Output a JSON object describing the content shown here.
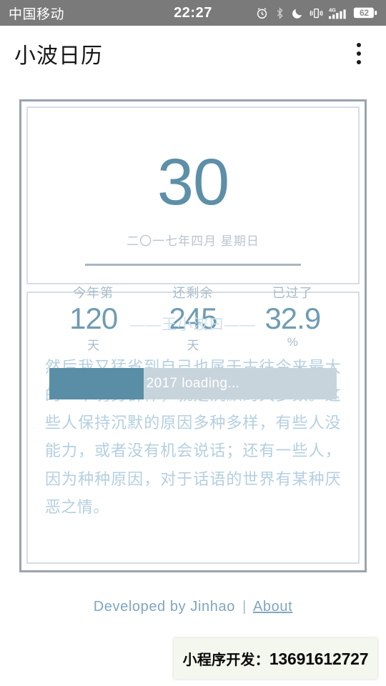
{
  "statusbar": {
    "carrier": "中国移动",
    "time": "22:27",
    "battery_level": "62",
    "icons": [
      "alarm-icon",
      "bluetooth-icon",
      "moon-icon",
      "vibrate-icon",
      "signal-4g-icon",
      "battery-icon"
    ]
  },
  "appbar": {
    "title": "小波日历",
    "overflow_icon": "more-vertical-icon"
  },
  "calendar": {
    "day": "30",
    "date_line": "二〇一七年四月 星期日",
    "stats": [
      {
        "label": "今年第",
        "value": "120",
        "unit": "天"
      },
      {
        "label": "还剩余",
        "value": "245",
        "unit": "天"
      },
      {
        "label": "已过了",
        "value": "32.9",
        "unit": "%"
      }
    ],
    "progress": {
      "text": "2017 loading...",
      "percent": 32.9,
      "fill_color": "#5a8da6",
      "track_color": "#c8d4dc"
    }
  },
  "quote": {
    "heading": "——王小波曰——",
    "text": "然后我又猛省到自己也属于古往今来最大的一个弱势群体，就是沉默的大多数。这些人保持沉默的原因多种多样，有些人没能力，或者没有机会说话；还有一些人，因为种种原因，对于话语的世界有某种厌恶之情。"
  },
  "footer": {
    "credit": "Developed by Jinhao",
    "separator": "|",
    "link": "About"
  },
  "ad": {
    "label": "小程序开发：",
    "phone": "13691612727"
  },
  "colors": {
    "accent": "#5a8da6",
    "muted": "#a9bcc9",
    "frame": "#9aa4b0",
    "status_bg": "#7a7a7a"
  }
}
